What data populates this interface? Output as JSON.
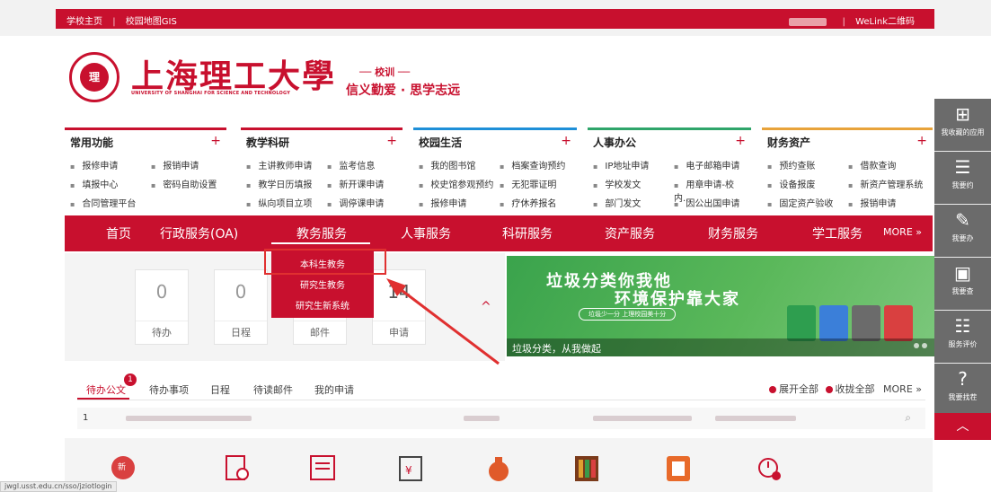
{
  "topbar": {
    "left_links": [
      "学校主页",
      "校园地图GIS"
    ],
    "separator": "|",
    "right_link": "WeLink二维码"
  },
  "header": {
    "logo_text": "理",
    "university_cn": "上海理工大學",
    "university_en": "UNIVERSITY OF SHANGHAI FOR SCIENCE AND TECHNOLOGY",
    "motto_title": "── 校训 ──",
    "motto": "信义勤爱 · 思学志远"
  },
  "quick": [
    {
      "title": "常用功能",
      "items": [
        "报修申请",
        "报销申请",
        "填报中心",
        "密码自助设置",
        "合同管理平台"
      ]
    },
    {
      "title": "教学科研",
      "items": [
        "主讲教师申请",
        "监考信息",
        "教学日历填报",
        "新开课申请",
        "纵向项目立项",
        "调停课申请"
      ]
    },
    {
      "title": "校园生活",
      "items": [
        "我的图书馆",
        "档案查询预约",
        "校史馆参观预约",
        "无犯罪证明",
        "报修申请",
        "疗休养报名"
      ]
    },
    {
      "title": "人事办公",
      "items": [
        "IP地址申请",
        "电子邮箱申请",
        "学校发文",
        "用章申请-校内...",
        "部门发文",
        "因公出国申请"
      ]
    },
    {
      "title": "财务资产",
      "items": [
        "预约查账",
        "借款查询",
        "设备报废",
        "新资产管理系统",
        "固定资产验收",
        "报销申请"
      ]
    }
  ],
  "plus": "+",
  "nav": {
    "items": [
      "首页",
      "行政服务(OA)",
      "教务服务",
      "人事服务",
      "科研服务",
      "资产服务",
      "财务服务",
      "学工服务"
    ],
    "more": "MORE »"
  },
  "dropdown": [
    "本科生教务",
    "研究生教务",
    "研究生新系统"
  ],
  "cards": [
    {
      "value": "0",
      "label": "待办"
    },
    {
      "value": "0",
      "label": "日程"
    },
    {
      "value": "",
      "label": "邮件"
    },
    {
      "value": "14",
      "label": "申请"
    }
  ],
  "caret": "^",
  "banner": {
    "line1": "垃圾分类你我他",
    "line2": "环境保护靠大家",
    "pill": "垃圾少一分 上理校园美十分",
    "caption": "垃圾分类，从我做起"
  },
  "tabs": {
    "items": [
      "待办公文",
      "待办事项",
      "日程",
      "待读邮件",
      "我的申请"
    ],
    "badge": "1",
    "expand": "展开全部",
    "collapse": "收拢全部",
    "more": "MORE »",
    "row_num": "1"
  },
  "sidebar": [
    {
      "icon": "⊞",
      "label": "我收藏的应用"
    },
    {
      "icon": "☰",
      "label": "我要约"
    },
    {
      "icon": "✎",
      "label": "我要办"
    },
    {
      "icon": "▣",
      "label": "我要查"
    },
    {
      "icon": "☷",
      "label": "服务评价"
    },
    {
      "icon": "?",
      "label": "我要找茬"
    }
  ],
  "sidebar_up": "︿",
  "status_url": "jwgl.usst.edu.cn/sso/jziotlogin",
  "bottom_badge": "新",
  "colors": {
    "brand": "#c8102e",
    "highlight": "#e03030"
  }
}
